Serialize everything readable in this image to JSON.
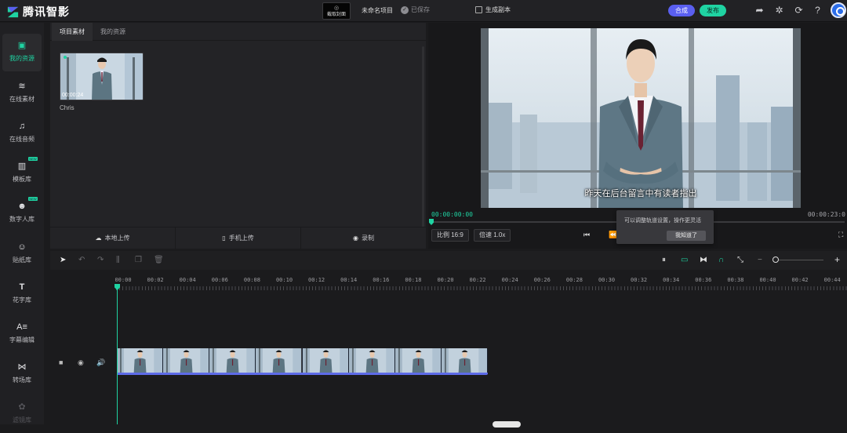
{
  "header": {
    "app_name": "腾讯智影",
    "cover_button": "截取封面",
    "project_name": "未命名项目",
    "save_status": "已保存",
    "generate_copy": "生成副本",
    "synthesize": "合成",
    "publish": "发布",
    "colors": {
      "accent": "#1fd3a2",
      "synthesize": "#5a5ff0"
    }
  },
  "sidebar": {
    "items": [
      {
        "label": "我的资源",
        "icon": "upload-icon",
        "active": true
      },
      {
        "label": "在线素材",
        "icon": "layers-icon"
      },
      {
        "label": "在线音频",
        "icon": "music-icon"
      },
      {
        "label": "模板库",
        "icon": "template-icon",
        "badge": "NEW"
      },
      {
        "label": "数字人库",
        "icon": "digital-human-icon",
        "badge": "NEW"
      },
      {
        "label": "贴纸库",
        "icon": "sticker-icon"
      },
      {
        "label": "花字库",
        "icon": "text-icon"
      },
      {
        "label": "字幕编辑",
        "icon": "subtitle-icon"
      },
      {
        "label": "转场库",
        "icon": "transition-icon"
      },
      {
        "label": "滤镜库",
        "icon": "filter-icon"
      }
    ]
  },
  "resources": {
    "tabs": [
      "项目素材",
      "我的资源"
    ],
    "item": {
      "duration": "00:00:24",
      "name": "Chris"
    },
    "upload": [
      "本地上传",
      "手机上传",
      "录制"
    ]
  },
  "preview": {
    "subtitle": "昨天在后台留言中有读者指出",
    "current_time": "00:00:00:00",
    "total_time": "00:00:23:0",
    "ratio": "比例 16:9",
    "speed": "倍速 1.0x"
  },
  "tooltip": {
    "text": "可以调整轨道设置，操作更灵活",
    "button": "我知道了"
  },
  "timeline": {
    "ruler": [
      "00:00",
      "00:02",
      "00:04",
      "00:06",
      "00:08",
      "00:10",
      "00:12",
      "00:14",
      "00:16",
      "00:18",
      "00:20",
      "00:22",
      "00:24",
      "00:26",
      "00:28",
      "00:30",
      "00:32",
      "00:34",
      "00:36",
      "00:38",
      "00:40",
      "00:42",
      "00:44"
    ],
    "clip_frames": 8
  }
}
